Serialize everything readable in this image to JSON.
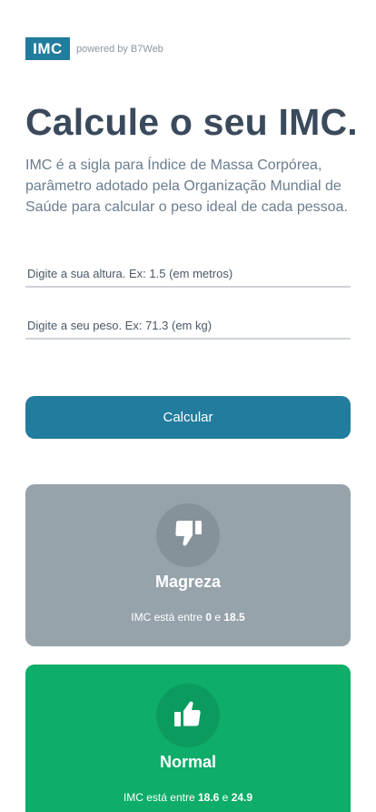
{
  "header": {
    "logo": "IMC",
    "powered_by": "powered by B7Web"
  },
  "main": {
    "title": "Calcule o seu IMC.",
    "description": "IMC é a sigla para Índice de Massa Corpórea, parâmetro adotado pela Organização Mundial de Saúde para calcular o peso ideal de cada pessoa."
  },
  "form": {
    "altura_placeholder": "Digite a sua altura. Ex: 1.5 (em metros)",
    "peso_placeholder": "Digite a seu peso. Ex: 71.3 (em kg)",
    "calc_label": "Calcular"
  },
  "cards": [
    {
      "title": "Magreza",
      "info_prefix": "IMC está entre",
      "min": "0",
      "connector": "e",
      "max": "18.5",
      "icon": "thumbs-down-icon",
      "color": "#96a3ab"
    },
    {
      "title": "Normal",
      "info_prefix": "IMC está entre",
      "min": "18.6",
      "connector": "e",
      "max": "24.9",
      "icon": "thumbs-up-icon",
      "color": "#0ead69"
    }
  ],
  "colors": {
    "accent": "#227c9d",
    "title_text": "#3a4a5c",
    "body_text": "#6a7d8e"
  }
}
